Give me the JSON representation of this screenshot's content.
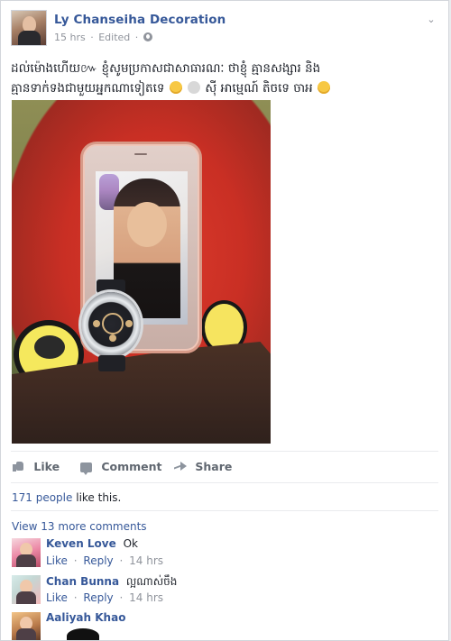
{
  "post": {
    "author": "Ly Chanseiha Decoration",
    "time": "15 hrs",
    "edited": "Edited",
    "separator": "·",
    "text_line1": "ដល់ម៉ោងហើយ៚ ខ្ញុំសូមប្រកាសជាសាធារណៈ ថាខ្ញុំ គ្មានសង្សារ និង",
    "text_line2": "គ្មានទាក់ទងជាមួយអ្នកណាទៀតទេ",
    "text_line2_tail": "ស៊ី អាម្មេណ៍ តិចទេ ចាអ"
  },
  "actions": {
    "like": "Like",
    "comment": "Comment",
    "share": "Share"
  },
  "likes": {
    "count_text": "171 people",
    "suffix": "like this."
  },
  "comments": {
    "view_more": "View 13 more comments",
    "items": [
      {
        "author": "Keven Love",
        "text": "Ok",
        "like": "Like",
        "reply": "Reply",
        "time": "14 hrs",
        "separator": "·"
      },
      {
        "author": "Chan Bunna",
        "text": "ល្អណាស់ចឹង",
        "like": "Like",
        "reply": "Reply",
        "time": "14 hrs",
        "separator": "·"
      },
      {
        "author": "Aaliyah Khao",
        "text": ""
      }
    ]
  },
  "icons": {
    "chevron": "chevron-down-icon",
    "globe": "globe-icon",
    "like": "like-icon",
    "comment": "comment-icon",
    "share": "share-icon"
  },
  "colors": {
    "link": "#365899",
    "muted": "#90949c",
    "text": "#1d2129",
    "background": "#ffffff"
  }
}
